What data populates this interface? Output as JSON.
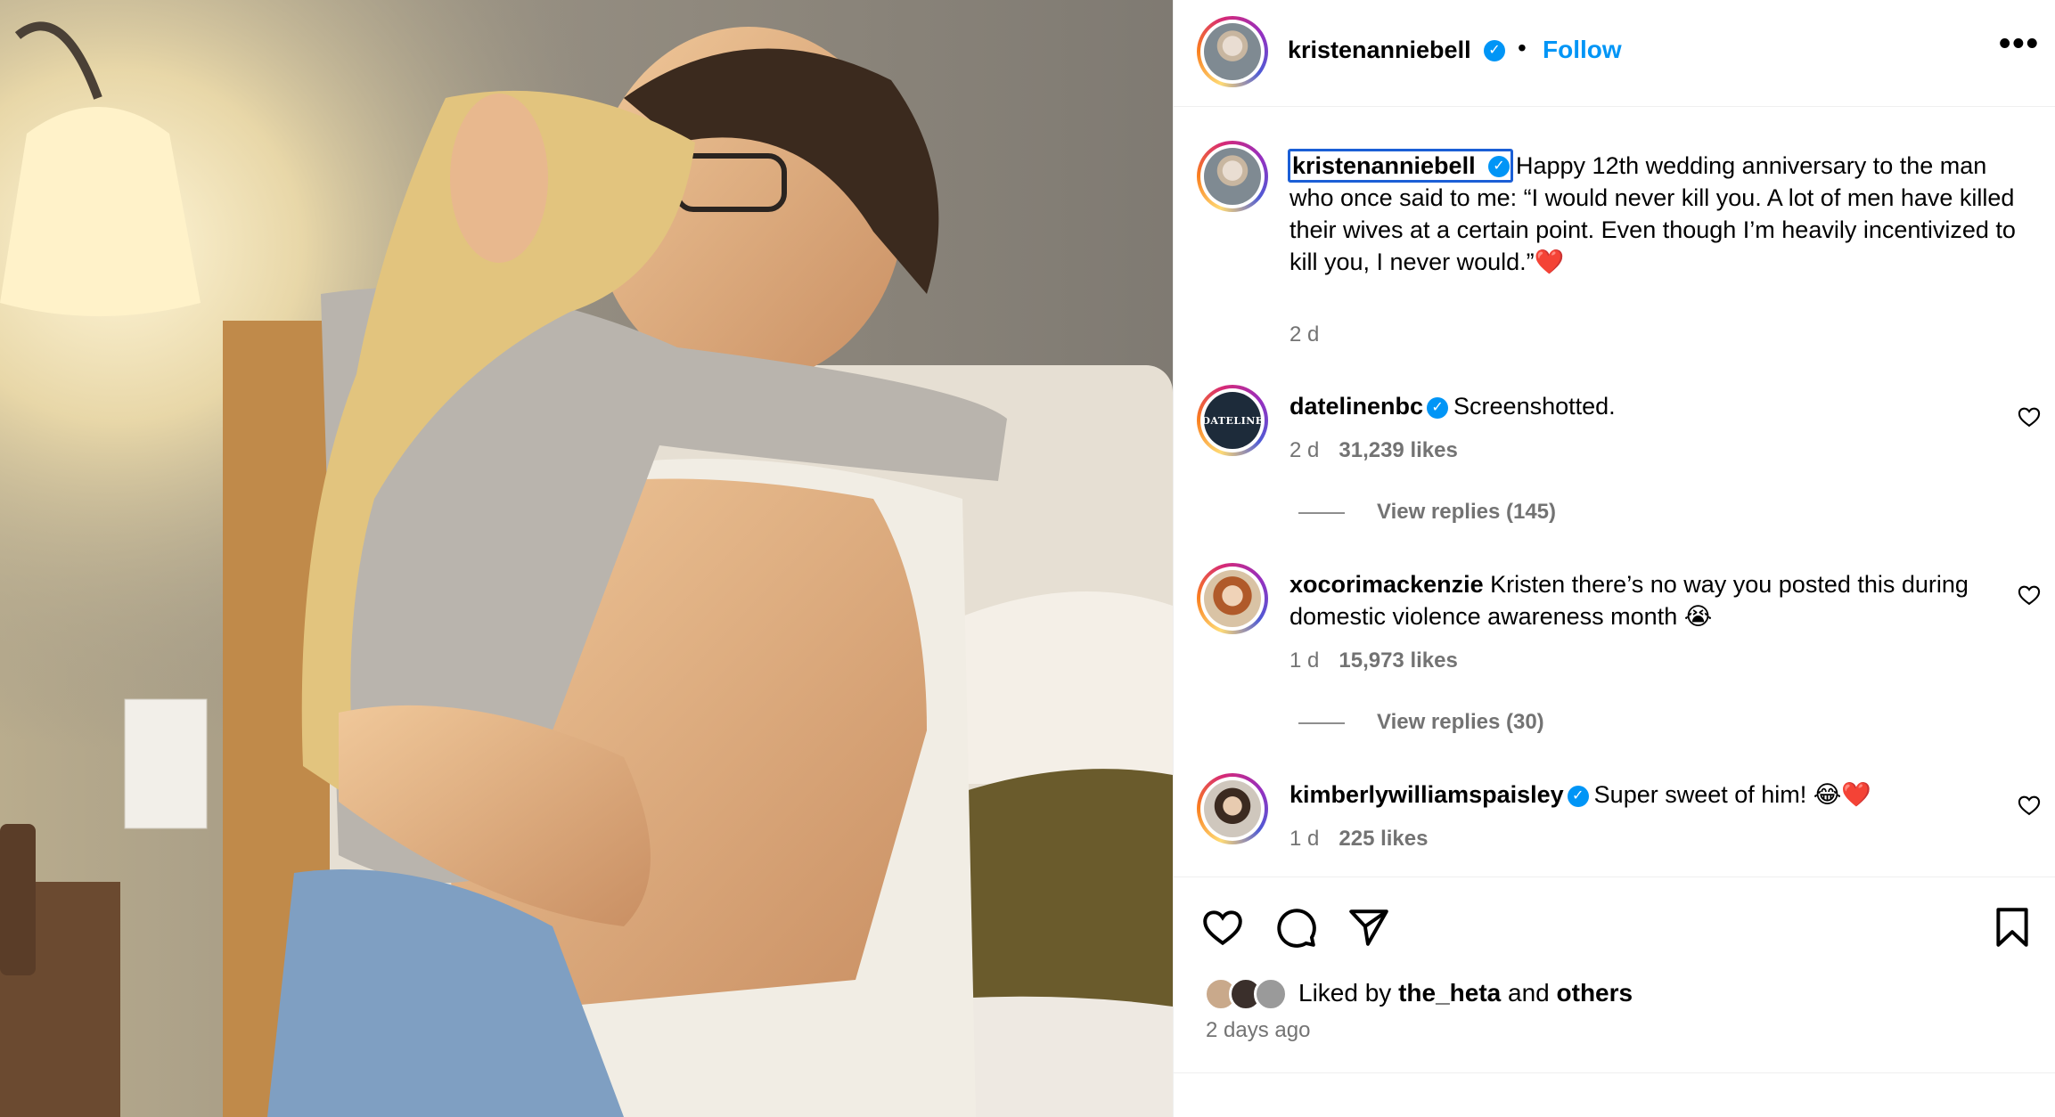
{
  "post": {
    "author": "kristenanniebell",
    "follow_label": "Follow",
    "separator": "•",
    "more_label": "•••",
    "verified_mark": "✓",
    "icons": [
      "verified-badge-icon",
      "more-options-icon",
      "heart-icon",
      "comment-icon",
      "share-icon",
      "bookmark-icon"
    ]
  },
  "caption": {
    "username": "kristenanniebell",
    "text": "Happy 12th wedding anniversary to the man who once said to me: “I would never kill you. A lot of men have killed their wives at a certain point. Even though I’m heavily incentivized to kill you, I never would.”❤️",
    "time": "2 d"
  },
  "comments": [
    {
      "username": "datelinenbc",
      "verified": true,
      "avatar_label": "DATELINE",
      "text": "Screenshotted.",
      "time": "2 d",
      "likes": "31,239 likes",
      "replies": "View replies (145)"
    },
    {
      "username": "xocorimackenzie",
      "verified": false,
      "text": "Kristen there’s no way you posted this during domestic violence awareness month 😭",
      "time": "1 d",
      "likes": "15,973 likes",
      "replies": "View replies (30)"
    },
    {
      "username": "kimberlywilliamspaisley",
      "verified": true,
      "text": "Super sweet of him! 😂❤️",
      "time": "1 d",
      "likes": "225 likes"
    }
  ],
  "footer": {
    "liked_by_prefix": "Liked by",
    "liked_by_user": "the_heta",
    "liked_by_join": "and",
    "liked_by_others": "others",
    "post_time": "2 days ago"
  },
  "colors": {
    "accent_blue": "#0095f6",
    "secondary_text": "#737373",
    "focus_outline": "#1b5fd6"
  }
}
